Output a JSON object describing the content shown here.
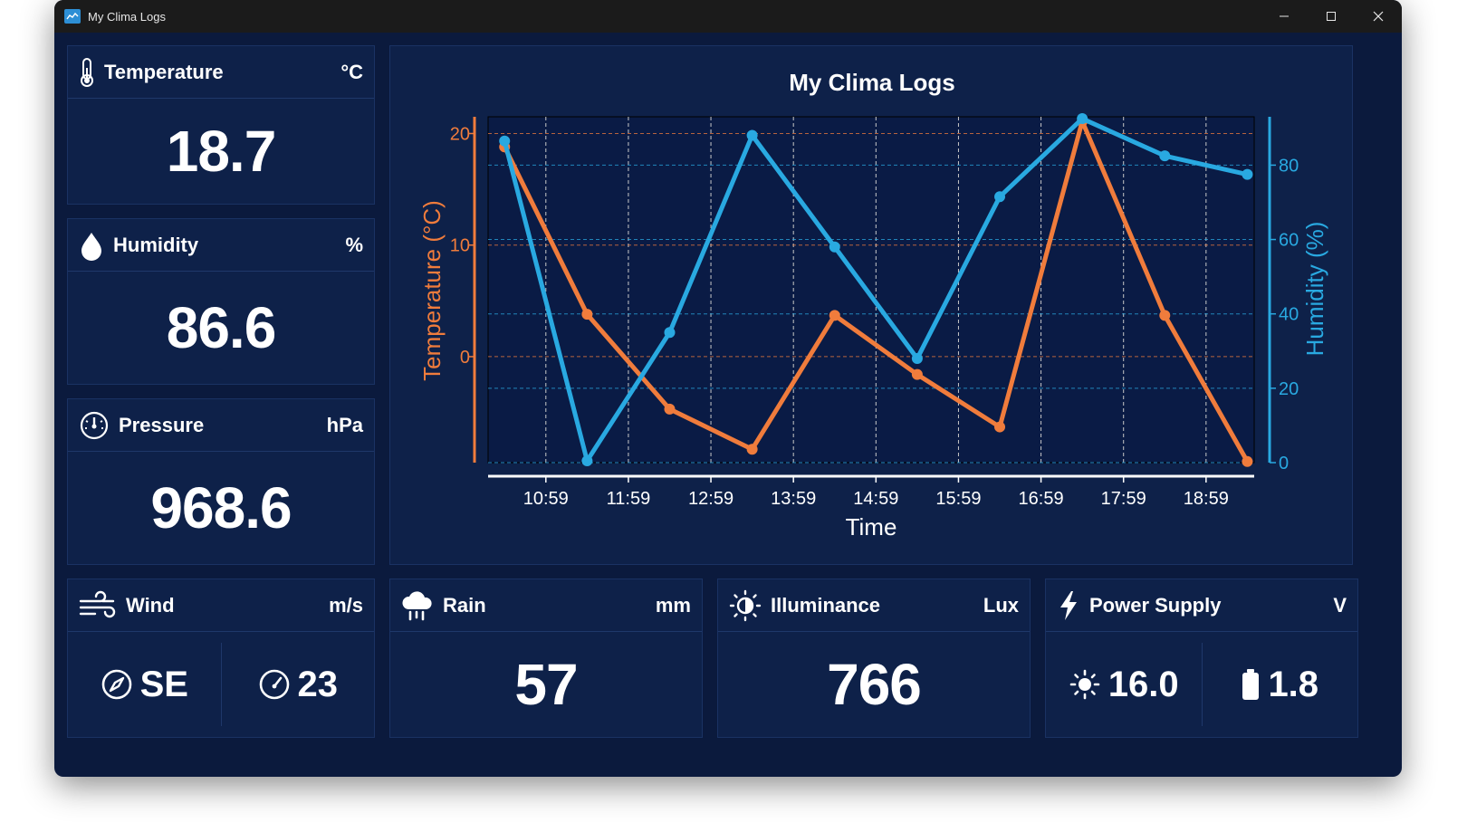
{
  "window": {
    "title": "My Clima Logs"
  },
  "cards": {
    "temperature": {
      "label": "Temperature",
      "unit": "°C",
      "value": "18.7",
      "icon": "thermometer-icon"
    },
    "humidity": {
      "label": "Humidity",
      "unit": "%",
      "value": "86.6",
      "icon": "droplet-icon"
    },
    "pressure": {
      "label": "Pressure",
      "unit": "hPa",
      "value": "968.6",
      "icon": "gauge-icon"
    },
    "wind": {
      "label": "Wind",
      "unit": "m/s",
      "direction": "SE",
      "speed": "23",
      "icon": "wind-icon"
    },
    "rain": {
      "label": "Rain",
      "unit": "mm",
      "value": "57",
      "icon": "rain-cloud-icon"
    },
    "illuminance": {
      "label": "Illuminance",
      "unit": "Lux",
      "value": "766",
      "icon": "brightness-icon"
    },
    "power": {
      "label": "Power Supply",
      "unit": "V",
      "solar": "16.0",
      "battery": "1.8",
      "icon": "lightning-icon"
    }
  },
  "colors": {
    "temperature": "#f07c3c",
    "humidity": "#29a9e1",
    "background": "#0b1a3d",
    "panel": "#0e2149"
  },
  "chart_data": {
    "type": "line",
    "title": "My Clima Logs",
    "xlabel": "Time",
    "ylabel_left": "Temperature (°C)",
    "ylabel_right": "Humidity (%)",
    "x_ticks": [
      "10:59",
      "11:59",
      "12:59",
      "13:59",
      "14:59",
      "15:59",
      "16:59",
      "17:59",
      "18:59"
    ],
    "x": [
      "10:29",
      "11:29",
      "12:29",
      "13:29",
      "14:29",
      "15:29",
      "16:29",
      "17:29",
      "18:29",
      "19:29"
    ],
    "y_left_ticks": [
      0,
      10,
      20
    ],
    "y_right_ticks": [
      0,
      20,
      40,
      60,
      80
    ],
    "ylim_left": [
      -9.5,
      21.5
    ],
    "ylim_right": [
      0,
      93
    ],
    "grid": true,
    "series": [
      {
        "name": "Temperature",
        "axis": "left",
        "color": "#f07c3c",
        "values": [
          18.8,
          3.8,
          -4.7,
          -8.3,
          3.7,
          -1.6,
          -6.3,
          21.1,
          3.7,
          -9.4
        ]
      },
      {
        "name": "Humidity",
        "axis": "right",
        "color": "#29a9e1",
        "values": [
          86.5,
          0.5,
          35.0,
          88.0,
          58.0,
          28.0,
          71.5,
          92.5,
          82.5,
          77.5
        ]
      }
    ]
  }
}
